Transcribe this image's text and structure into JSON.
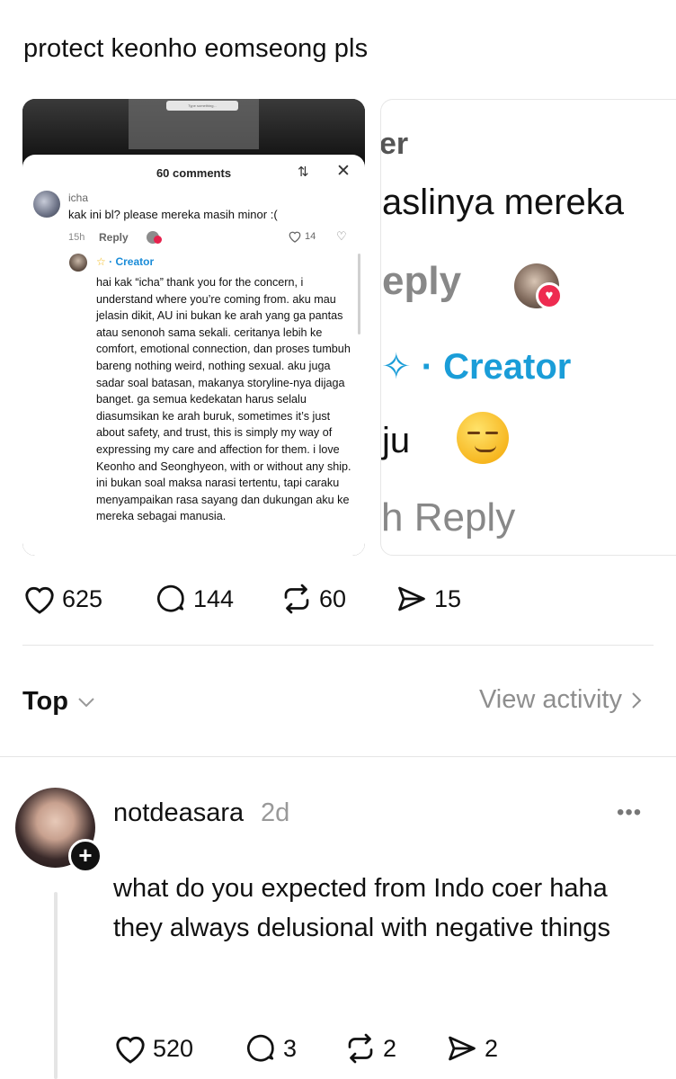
{
  "post": {
    "text": "protect keonho eomseong pls",
    "stats": {
      "likes": "625",
      "comments": "144",
      "reposts": "60",
      "shares": "15"
    }
  },
  "screenshot_card": {
    "input_placeholder": "Type something...",
    "comments_title": "60 comments",
    "comment": {
      "author": "icha",
      "text": "kak ini bl? please mereka masih minor :(",
      "age": "15h",
      "reply_label": "Reply",
      "likes": "14"
    },
    "creator_reply": {
      "badge": "· Creator",
      "text": "hai kak “icha” thank you for the concern, i understand where you’re coming from. aku mau jelasin dikit, AU ini bukan ke arah yang ga pantas atau senonoh sama sekali. ceritanya lebih ke comfort, emotional connection, dan proses tumbuh bareng nothing weird, nothing sexual. aku juga sadar soal batasan, makanya storyline-nya dijaga banget. ga semua kedekatan harus selalu diasumsikan ke arah buruk, sometimes it’s just about safety, and trust, this is simply my way of expressing my care and affection for them. i love Keonho and Seonghyeon, with or without any ship. ini bukan soal maksa narasi tertentu, tapi caraku menyampaikan rasa sayang dan dukungan aku ke mereka sebagai manusia."
    }
  },
  "zoom_card": {
    "line1": "er",
    "line2": "aslinya mereka",
    "line3": "eply",
    "line4": "✧ · Creator",
    "line5": "ju",
    "line6": "h   Reply"
  },
  "sort": {
    "label": "Top",
    "view_activity": "View activity"
  },
  "reply": {
    "username": "notdeasara",
    "time": "2d",
    "more": "•••",
    "text": "what do you expected from Indo coer haha they always delusional with negative things",
    "stats": {
      "likes": "520",
      "comments": "3",
      "reposts": "2",
      "shares": "2"
    }
  },
  "icons": [
    "heart-icon",
    "comment-icon",
    "repost-icon",
    "share-icon",
    "chevron-down-icon",
    "chevron-right-icon",
    "sort-icon",
    "close-icon",
    "plus-icon",
    "more-icon"
  ]
}
